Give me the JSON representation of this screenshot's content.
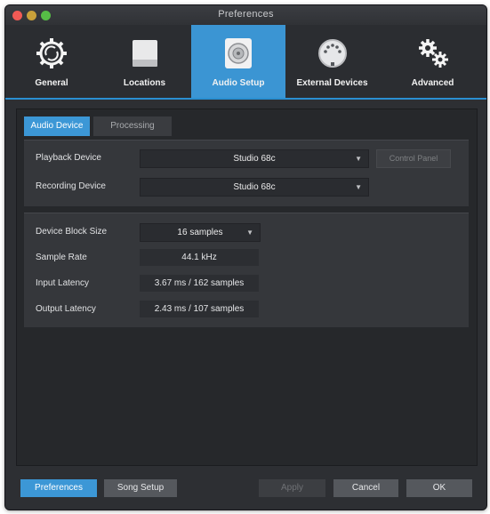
{
  "window": {
    "title": "Preferences"
  },
  "toolbar": {
    "items": [
      {
        "label": "General",
        "icon": "general-gear-icon",
        "active": false
      },
      {
        "label": "Locations",
        "icon": "drive-icon",
        "active": false
      },
      {
        "label": "Audio Setup",
        "icon": "speaker-icon",
        "active": true
      },
      {
        "label": "External Devices",
        "icon": "midi-connector-icon",
        "active": false
      },
      {
        "label": "Advanced",
        "icon": "gears-icon",
        "active": false
      }
    ],
    "accent": "#3b95d3"
  },
  "tabs": [
    {
      "label": "Audio Device",
      "active": true
    },
    {
      "label": "Processing",
      "active": false
    }
  ],
  "devices": {
    "playback_label": "Playback Device",
    "playback_value": "Studio 68c",
    "recording_label": "Recording Device",
    "recording_value": "Studio 68c",
    "control_panel": "Control Panel"
  },
  "settings": {
    "block_size_label": "Device Block Size",
    "block_size_value": "16 samples",
    "sample_rate_label": "Sample Rate",
    "sample_rate_value": "44.1 kHz",
    "input_latency_label": "Input Latency",
    "input_latency_value": "3.67 ms / 162 samples",
    "output_latency_label": "Output Latency",
    "output_latency_value": "2.43 ms / 107 samples"
  },
  "footer": {
    "preferences": "Preferences",
    "song_setup": "Song Setup",
    "apply": "Apply",
    "cancel": "Cancel",
    "ok": "OK"
  }
}
